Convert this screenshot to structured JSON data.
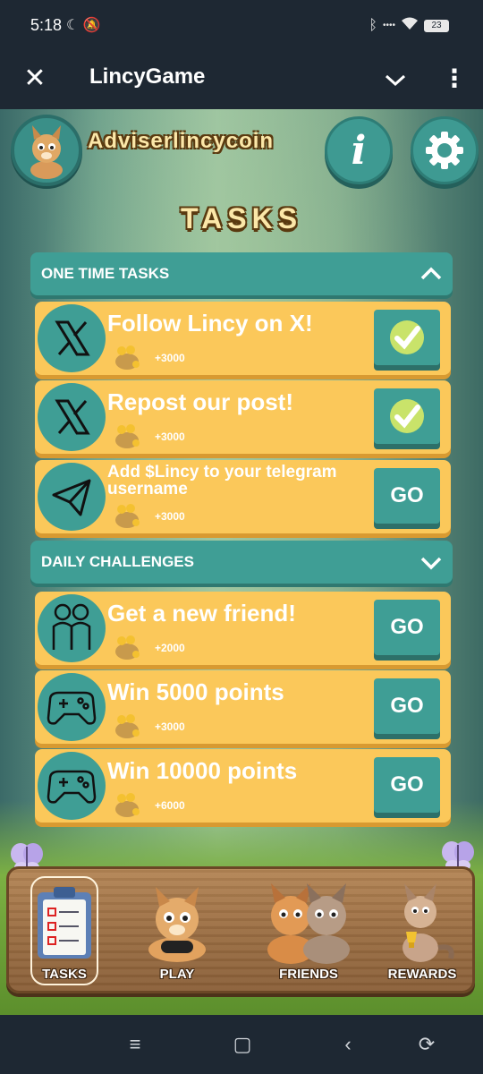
{
  "status_bar": {
    "time": "5:18",
    "icons": [
      "moon-icon",
      "mute-icon",
      "bluetooth-icon",
      "wifi-icon",
      "battery-icon"
    ],
    "battery_level": "23"
  },
  "app_bar": {
    "title": "LincyGame",
    "close_icon": "close-icon",
    "dropdown_icon": "chevron-down-icon",
    "menu_icon": "more-vert-icon"
  },
  "header": {
    "username": "Adviserlincycoin",
    "info_label": "i"
  },
  "page": {
    "title": "TASKS"
  },
  "sections": {
    "one_time": {
      "label": "ONE TIME TASKS",
      "expanded": true,
      "tasks": [
        {
          "icon": "x-logo-icon",
          "name": "Follow Lincy on X!",
          "reward": "+3000",
          "status": "completed"
        },
        {
          "icon": "x-logo-icon",
          "name": "Repost our post!",
          "reward": "+3000",
          "status": "completed"
        },
        {
          "icon": "telegram-icon",
          "name": "Add $Lincy to your telegram username",
          "reward": "+3000",
          "status": "pending",
          "action": "GO"
        }
      ]
    },
    "daily": {
      "label": "DAILY CHALLENGES",
      "expanded": false,
      "tasks": [
        {
          "icon": "friends-icon",
          "name": "Get a new friend!",
          "reward": "+2000",
          "action": "GO"
        },
        {
          "icon": "gamepad-icon",
          "name": "Win 5000 points",
          "reward": "+3000",
          "action": "GO"
        },
        {
          "icon": "gamepad-icon",
          "name": "Win 10000 points",
          "reward": "+6000",
          "action": "GO"
        }
      ]
    }
  },
  "bottom_nav": {
    "items": [
      {
        "label": "TASKS",
        "active": true
      },
      {
        "label": "PLAY",
        "active": false
      },
      {
        "label": "FRIENDS",
        "active": false
      },
      {
        "label": "REWARDS",
        "active": false
      }
    ]
  },
  "system_nav": [
    "menu-icon",
    "home-icon",
    "back-icon",
    "rotate-icon"
  ],
  "colors": {
    "teal": "#3f9e95",
    "card": "#fbc85a",
    "card_shadow": "#d89a31",
    "wood": "#9b6e43",
    "bar": "#1e2833"
  }
}
